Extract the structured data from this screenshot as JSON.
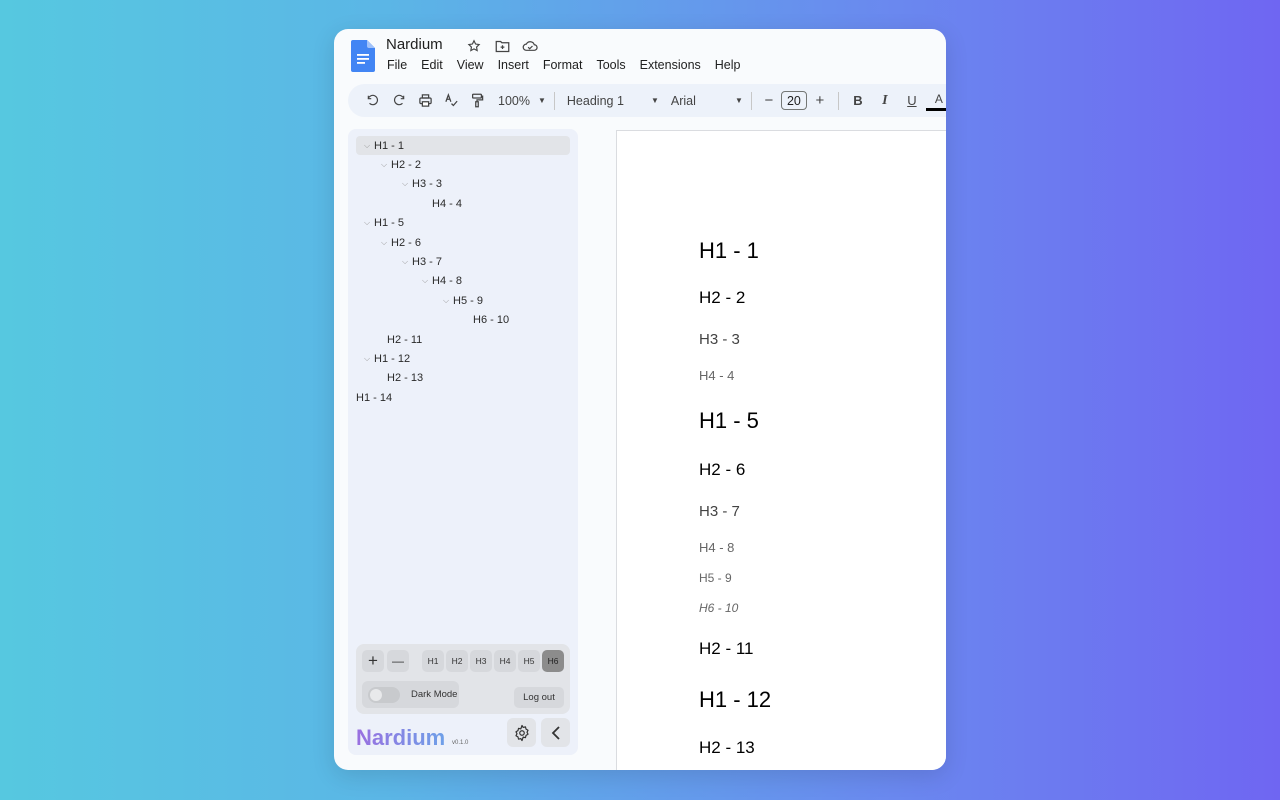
{
  "app": {
    "doc_title": "Nardium",
    "title_icons": [
      "star-icon",
      "move-to-folder-icon",
      "cloud-status-icon"
    ],
    "menu": [
      "File",
      "Edit",
      "View",
      "Insert",
      "Format",
      "Tools",
      "Extensions",
      "Help"
    ]
  },
  "toolbar": {
    "zoom": "100%",
    "style": "Heading 1",
    "font": "Arial",
    "font_size": "20",
    "minus": "−",
    "plus": "+",
    "bold": "B",
    "italic": "I",
    "underline": "U",
    "text_color": "A"
  },
  "outline": {
    "items": [
      {
        "label": "H1 - 1",
        "level": 1,
        "collapsible": true,
        "active": true
      },
      {
        "label": "H2 - 2",
        "level": 2,
        "collapsible": true
      },
      {
        "label": "H3 - 3",
        "level": 3,
        "collapsible": true
      },
      {
        "label": "H4 - 4",
        "level": 4,
        "collapsible": false
      },
      {
        "label": "H1 - 5",
        "level": 1,
        "collapsible": true
      },
      {
        "label": "H2 - 6",
        "level": 2,
        "collapsible": true
      },
      {
        "label": "H3 - 7",
        "level": 3,
        "collapsible": true
      },
      {
        "label": "H4 - 8",
        "level": 4,
        "collapsible": true
      },
      {
        "label": "H5 - 9",
        "level": 5,
        "collapsible": true
      },
      {
        "label": "H6 - 10",
        "level": 6,
        "collapsible": false
      },
      {
        "label": "H2 - 11",
        "level": 2,
        "collapsible": false
      },
      {
        "label": "H1 - 12",
        "level": 1,
        "collapsible": true
      },
      {
        "label": "H2 - 13",
        "level": 2,
        "collapsible": false
      },
      {
        "label": "H1 - 14",
        "level": 1,
        "collapsible": false,
        "root_flush": true
      }
    ]
  },
  "controls": {
    "expand": "+",
    "collapse": "—",
    "levels": [
      "H1",
      "H2",
      "H3",
      "H4",
      "H5",
      "H6"
    ],
    "active_level": "H6",
    "dark_mode_label": "Dark Mode",
    "dark_mode_on": false,
    "logout_label": "Log out"
  },
  "brand": {
    "name": "Nardium",
    "version": "v0.1.0"
  },
  "document": {
    "headings": [
      {
        "text": "H1 - 1",
        "level": 1
      },
      {
        "text": "H2 - 2",
        "level": 2
      },
      {
        "text": "H3 - 3",
        "level": 3
      },
      {
        "text": "H4 - 4",
        "level": 4
      },
      {
        "text": "H1 - 5",
        "level": 1
      },
      {
        "text": "H2 - 6",
        "level": 2
      },
      {
        "text": "H3 - 7",
        "level": 3
      },
      {
        "text": "H4 - 8",
        "level": 4
      },
      {
        "text": "H5 - 9",
        "level": 5
      },
      {
        "text": "H6 - 10",
        "level": 6
      },
      {
        "text": "H2 - 11",
        "level": 2
      },
      {
        "text": "H1 - 12",
        "level": 1
      },
      {
        "text": "H2 - 13",
        "level": 2
      }
    ]
  }
}
